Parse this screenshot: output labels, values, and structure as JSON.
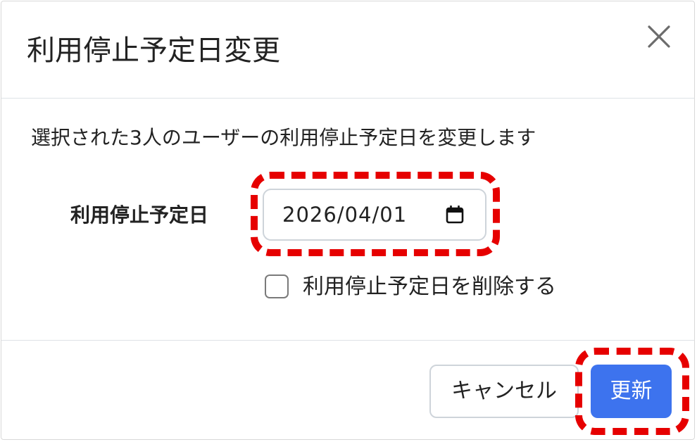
{
  "dialog": {
    "title": "利用停止予定日変更",
    "close_icon": "close-icon"
  },
  "body": {
    "message": "選択された3人のユーザーの利用停止予定日を変更します",
    "date_label": "利用停止予定日",
    "date_value": "2026/04/01",
    "calendar_icon": "calendar-icon",
    "delete_checkbox_label": "利用停止予定日を削除する",
    "delete_checkbox_checked": false
  },
  "footer": {
    "cancel_label": "キャンセル",
    "update_label": "更新"
  },
  "colors": {
    "primary": "#3d73ee",
    "highlight": "#e60000",
    "border": "#ced4da"
  }
}
